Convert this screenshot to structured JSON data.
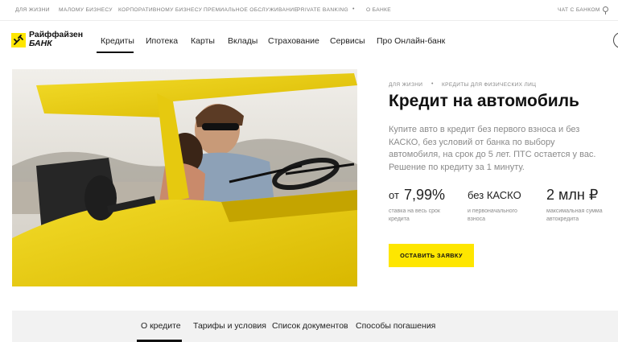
{
  "topbar": {
    "links": [
      "Для жизни",
      "Малому бизнесу",
      "Корпоративному бизнесу",
      "Премиальное обслуживание",
      "Private Banking",
      "О банке"
    ],
    "chat_label": "Чат с банком"
  },
  "logo": {
    "line1": "Райффайзен",
    "line2": "БАНК",
    "brand_color": "#fee600"
  },
  "nav": {
    "items": [
      "Кредиты",
      "Ипотека",
      "Карты",
      "Вклады",
      "Страхование",
      "Сервисы",
      "Про Онлайн-банк"
    ],
    "active": "Кредиты"
  },
  "breadcrumbs": [
    "Для жизни",
    "Кредиты для физических лиц"
  ],
  "title": "Кредит на автомобиль",
  "description": "Купите авто в кредит без первого взноса и без КАСКО, без условий от банка по выбору автомобиля, на срок до 5 лет. ПТС остается у вас. Решение по кредиту за 1 минуту.",
  "facts": [
    {
      "prefix": "от",
      "value": "7,99%",
      "caption": "ставка на весь срок кредита"
    },
    {
      "value": "без КАСКО",
      "caption": "и первоначального взноса"
    },
    {
      "value": "2 млн ₽",
      "caption": "максимальная сумма автокредита"
    }
  ],
  "apply_button": "Оставить заявку",
  "subtabs": [
    "О кредите",
    "Тарифы и условия",
    "Список документов",
    "Способы погашения"
  ],
  "active_subtab": "О кредите"
}
